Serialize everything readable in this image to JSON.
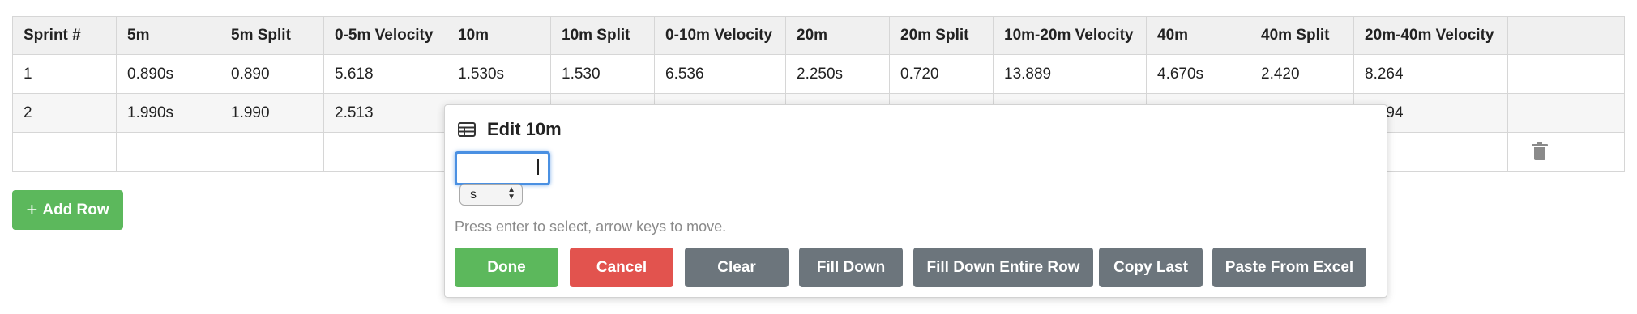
{
  "table": {
    "headers": [
      "Sprint #",
      "5m",
      "5m Split",
      "0-5m Velocity",
      "10m",
      "10m Split",
      "0-10m Velocity",
      "20m",
      "20m Split",
      "10m-20m Velocity",
      "40m",
      "40m Split",
      "20m-40m Velocity",
      ""
    ],
    "rows": [
      [
        "1",
        "0.890s",
        "0.890",
        "5.618",
        "1.530s",
        "1.530",
        "6.536",
        "2.250s",
        "0.720",
        "13.889",
        "4.670s",
        "2.420",
        "8.264",
        ""
      ],
      [
        "2",
        "1.990s",
        "1.990",
        "2.513",
        "",
        "",
        "",
        "",
        "",
        "",
        "",
        "",
        "4.494",
        ""
      ],
      [
        "",
        "",
        "",
        "",
        "",
        "",
        "",
        "",
        "",
        "",
        "",
        "",
        "",
        ""
      ]
    ]
  },
  "add_row_label": "Add Row",
  "editor": {
    "title": "Edit 10m",
    "input_value": "",
    "unit_selected": "s",
    "hint": "Press enter to select, arrow keys to move.",
    "buttons": {
      "done": "Done",
      "cancel": "Cancel",
      "clear": "Clear",
      "fill_down": "Fill Down",
      "fill_down_row": "Fill Down Entire Row",
      "copy_last": "Copy Last",
      "paste_excel": "Paste From Excel"
    }
  },
  "colors": {
    "green": "#5cb85c",
    "red": "#e2534e",
    "gray": "#6c757c",
    "focus_blue": "#4a90e2"
  },
  "icons": {
    "table": "table-icon",
    "trash": "trash-icon",
    "plus": "plus-icon"
  }
}
